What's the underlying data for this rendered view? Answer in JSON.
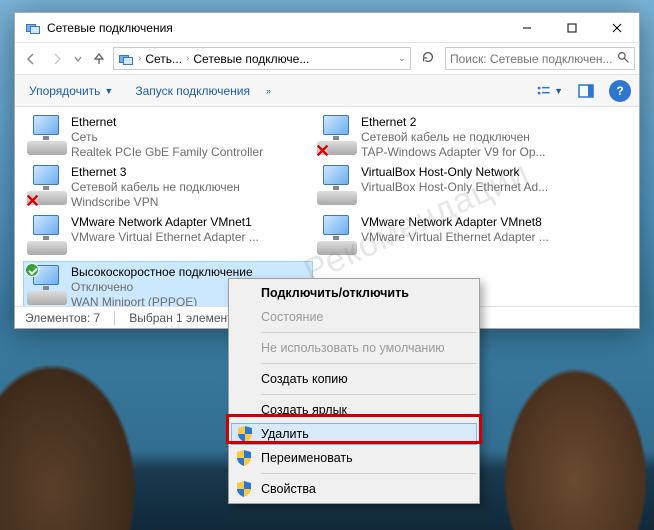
{
  "window": {
    "title": "Сетевые подключения"
  },
  "breadcrumb": {
    "seg1": "Сеть...",
    "seg2": "Сетевые подключе..."
  },
  "search": {
    "placeholder": "Поиск: Сетевые подключен..."
  },
  "toolbar": {
    "organize": "Упорядочить",
    "launch": "Запуск подключения"
  },
  "connections": [
    {
      "name": "Ethernet",
      "status": "Сеть",
      "device": "Realtek PCIe GbE Family Controller",
      "overlay": ""
    },
    {
      "name": "Ethernet 2",
      "status": "Сетевой кабель не подключен",
      "device": "TAP-Windows Adapter V9 for Op...",
      "overlay": "x"
    },
    {
      "name": "Ethernet 3",
      "status": "Сетевой кабель не подключен",
      "device": "Windscribe VPN",
      "overlay": "x"
    },
    {
      "name": "VirtualBox Host-Only Network",
      "status": "",
      "device": "VirtualBox Host-Only Ethernet Ad...",
      "overlay": ""
    },
    {
      "name": "VMware Network Adapter VMnet1",
      "status": "",
      "device": "VMware Virtual Ethernet Adapter ...",
      "overlay": ""
    },
    {
      "name": "VMware Network Adapter VMnet8",
      "status": "",
      "device": "VMware Virtual Ethernet Adapter ...",
      "overlay": ""
    },
    {
      "name": "Высокоскоростное подключение",
      "status": "Отключено",
      "device": "WAN Miniport (PPPOE)",
      "overlay": "check",
      "selected": true
    }
  ],
  "statusbar": {
    "count": "Элементов: 7",
    "selected": "Выбран 1 элемент"
  },
  "context_menu": [
    {
      "label": "Подключить/отключить",
      "kind": "bold"
    },
    {
      "label": "Состояние",
      "kind": "disabled"
    },
    {
      "kind": "sep"
    },
    {
      "label": "Не использовать по умолчанию",
      "kind": "disabled"
    },
    {
      "kind": "sep"
    },
    {
      "label": "Создать копию",
      "kind": ""
    },
    {
      "kind": "sep"
    },
    {
      "label": "Создать ярлык",
      "kind": ""
    },
    {
      "label": "Удалить",
      "kind": "selected",
      "icon": "shield"
    },
    {
      "label": "Переименовать",
      "kind": "",
      "icon": "shield"
    },
    {
      "kind": "sep"
    },
    {
      "label": "Свойства",
      "kind": "",
      "icon": "shield"
    }
  ],
  "watermark": "Рекомендации"
}
